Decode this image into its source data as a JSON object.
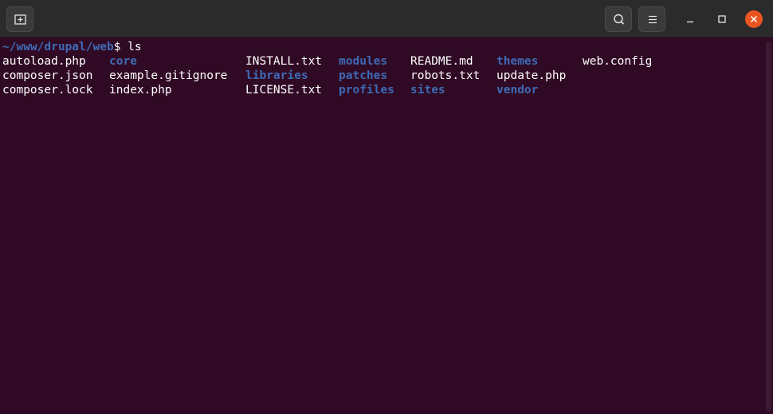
{
  "terminal": {
    "prompt_path": "~/www/drupal/web",
    "prompt_symbol": "$ ",
    "command": "ls",
    "rows": [
      [
        {
          "name": "autoload.php",
          "type": "file"
        },
        {
          "name": "core",
          "type": "dir"
        },
        {
          "name": "INSTALL.txt",
          "type": "file"
        },
        {
          "name": "modules",
          "type": "dir"
        },
        {
          "name": "README.md",
          "type": "file"
        },
        {
          "name": "themes",
          "type": "dir"
        },
        {
          "name": "web.config",
          "type": "file"
        }
      ],
      [
        {
          "name": "composer.json",
          "type": "file"
        },
        {
          "name": "example.gitignore",
          "type": "file"
        },
        {
          "name": "libraries",
          "type": "dir"
        },
        {
          "name": "patches",
          "type": "dir"
        },
        {
          "name": "robots.txt",
          "type": "file"
        },
        {
          "name": "update.php",
          "type": "file"
        }
      ],
      [
        {
          "name": "composer.lock",
          "type": "file"
        },
        {
          "name": "index.php",
          "type": "file"
        },
        {
          "name": "LICENSE.txt",
          "type": "file"
        },
        {
          "name": "profiles",
          "type": "dir"
        },
        {
          "name": "sites",
          "type": "dir"
        },
        {
          "name": "vendor",
          "type": "dir"
        }
      ]
    ]
  },
  "colors": {
    "background": "#300a24",
    "directory": "#3e6ab6",
    "close_button": "#e95420"
  },
  "icons": {
    "new_tab": "new-tab-icon",
    "search": "search-icon",
    "menu": "hamburger-menu-icon",
    "minimize": "minimize-icon",
    "maximize": "maximize-icon",
    "close": "close-icon"
  }
}
